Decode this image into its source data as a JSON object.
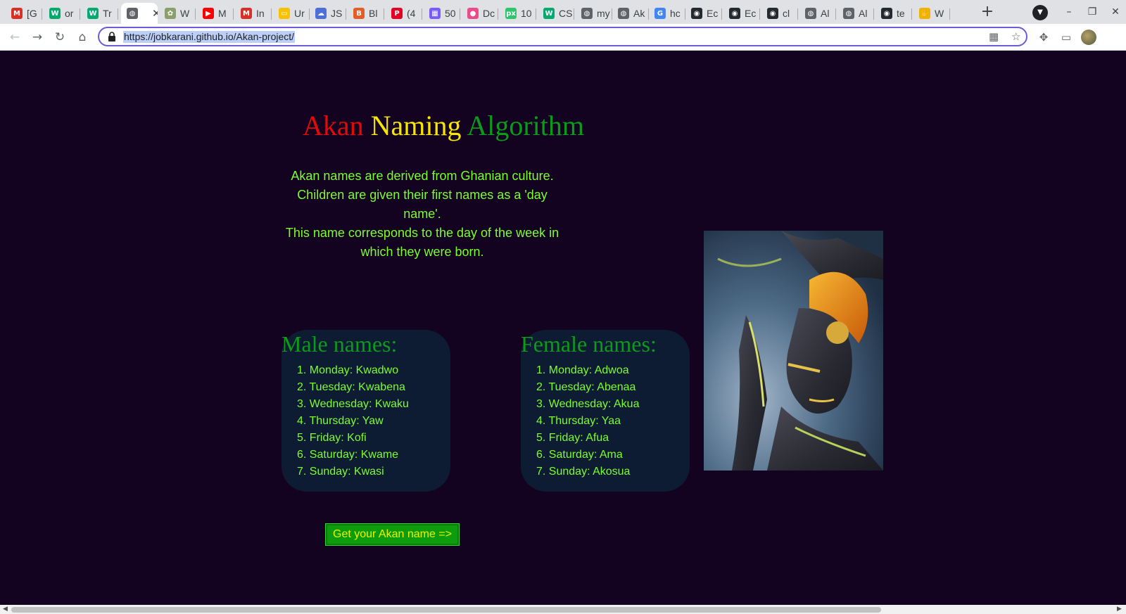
{
  "browser": {
    "tabs": [
      {
        "icon": "gmail-icon",
        "glyph": "M",
        "color": "#d93025",
        "title": "[G"
      },
      {
        "icon": "w3schools-icon",
        "glyph": "W",
        "color": "#04aa6d",
        "title": "or"
      },
      {
        "icon": "w3schools-icon",
        "glyph": "W",
        "color": "#04aa6d",
        "title": "Tr"
      },
      {
        "icon": "globe-icon",
        "glyph": "◍",
        "color": "#5f6368",
        "title": "",
        "active": true
      },
      {
        "icon": "tree-icon",
        "glyph": "✿",
        "color": "#8b9f6b",
        "title": "W"
      },
      {
        "icon": "youtube-icon",
        "glyph": "▶",
        "color": "#ff0000",
        "title": "M"
      },
      {
        "icon": "gmail-icon",
        "glyph": "M",
        "color": "#d93025",
        "title": "In"
      },
      {
        "icon": "notes-icon",
        "glyph": "▭",
        "color": "#f9c200",
        "title": "Ur"
      },
      {
        "icon": "cloud-icon",
        "glyph": "☁",
        "color": "#4f6fd8",
        "title": "JS"
      },
      {
        "icon": "badge-icon",
        "glyph": "B",
        "color": "#e35d2b",
        "title": "Bl"
      },
      {
        "icon": "pinterest-icon",
        "glyph": "P",
        "color": "#e60023",
        "title": "(4"
      },
      {
        "icon": "grid-icon",
        "glyph": "▦",
        "color": "#7a5af8",
        "title": "50"
      },
      {
        "icon": "dribbble-icon",
        "glyph": "●",
        "color": "#ea4c89",
        "title": "Dc"
      },
      {
        "icon": "pixabay-icon",
        "glyph": "px",
        "color": "#2ec66d",
        "title": "10"
      },
      {
        "icon": "w3schools-icon",
        "glyph": "W",
        "color": "#04aa6d",
        "title": "CS"
      },
      {
        "icon": "globe-icon",
        "glyph": "◍",
        "color": "#5f6368",
        "title": "my"
      },
      {
        "icon": "globe-icon",
        "glyph": "◍",
        "color": "#5f6368",
        "title": "Ak"
      },
      {
        "icon": "google-icon",
        "glyph": "G",
        "color": "#4285f4",
        "title": "hc"
      },
      {
        "icon": "github-icon",
        "glyph": "◉",
        "color": "#24292f",
        "title": "Ec"
      },
      {
        "icon": "github-icon",
        "glyph": "◉",
        "color": "#24292f",
        "title": "Ec"
      },
      {
        "icon": "github-icon",
        "glyph": "◉",
        "color": "#24292f",
        "title": "cl"
      },
      {
        "icon": "globe-icon",
        "glyph": "◍",
        "color": "#5f6368",
        "title": "Al"
      },
      {
        "icon": "globe-icon",
        "glyph": "◍",
        "color": "#5f6368",
        "title": "Al"
      },
      {
        "icon": "github-icon",
        "glyph": "◉",
        "color": "#24292f",
        "title": "te"
      },
      {
        "icon": "hand-icon",
        "glyph": "✋",
        "color": "#f0b400",
        "title": "W"
      }
    ],
    "url": "https://jobkarani.github.io/Akan-project/",
    "new_tab": "+",
    "tab_close": "✕"
  },
  "page": {
    "title_words": [
      "Akan",
      "Naming",
      "Algorithm"
    ],
    "intro_lines": [
      "Akan names are derived from Ghanian culture.",
      "Children are given their first names as a 'day name'.",
      "This name corresponds to the day of the week in which they were born."
    ],
    "male": {
      "heading": "Male names:",
      "items": [
        "Monday: Kwadwo",
        "Tuesday: Kwabena",
        "Wednesday: Kwaku",
        "Thursday: Yaw",
        "Friday: Kofi",
        "Saturday: Kwame",
        "Sunday: Kwasi"
      ]
    },
    "female": {
      "heading": "Female names:",
      "items": [
        "Monday: Adwoa",
        "Tuesday: Abenaa",
        "Wednesday: Akua",
        "Thursday: Yaa",
        "Friday: Afua",
        "Saturday: Ama",
        "Sunday: Akosua"
      ]
    },
    "cta_label": "Get your Akan name =>",
    "colors": {
      "background": "#130320",
      "title_red": "#e00a0a",
      "title_yellow": "#f6e600",
      "title_green": "#0b9b1a",
      "text_green": "#7dfd2e",
      "card": "#0d1c32",
      "button": "#0c9c0c"
    }
  }
}
